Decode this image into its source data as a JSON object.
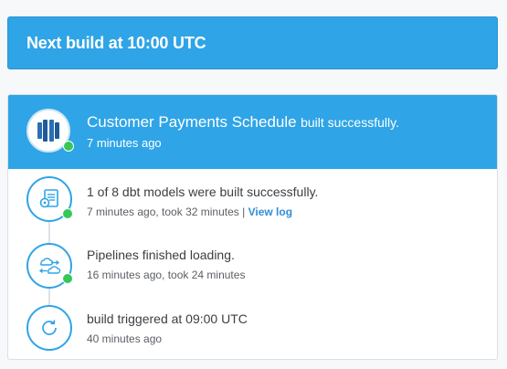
{
  "next_build": {
    "text": "Next build at 10:00 UTC"
  },
  "schedule": {
    "name": "Customer Payments Schedule",
    "status_text": "built successfully.",
    "time": "7 minutes ago",
    "icon": "redshift-database-icon"
  },
  "steps": [
    {
      "icon": "dbt-models-icon",
      "title": "1 of 8 dbt models were built successfully.",
      "meta": "7 minutes ago, took 32 minutes",
      "separator": "|",
      "link_label": "View log"
    },
    {
      "icon": "cloud-sync-icon",
      "title": "Pipelines finished loading.",
      "meta": "16 minutes ago, took 24 minutes"
    },
    {
      "icon": "refresh-icon",
      "title": "build triggered at 09:00 UTC",
      "meta": "40 minutes ago"
    }
  ],
  "colors": {
    "accent": "#2fa4e7",
    "success": "#34c759",
    "link": "#2f8fd6"
  }
}
